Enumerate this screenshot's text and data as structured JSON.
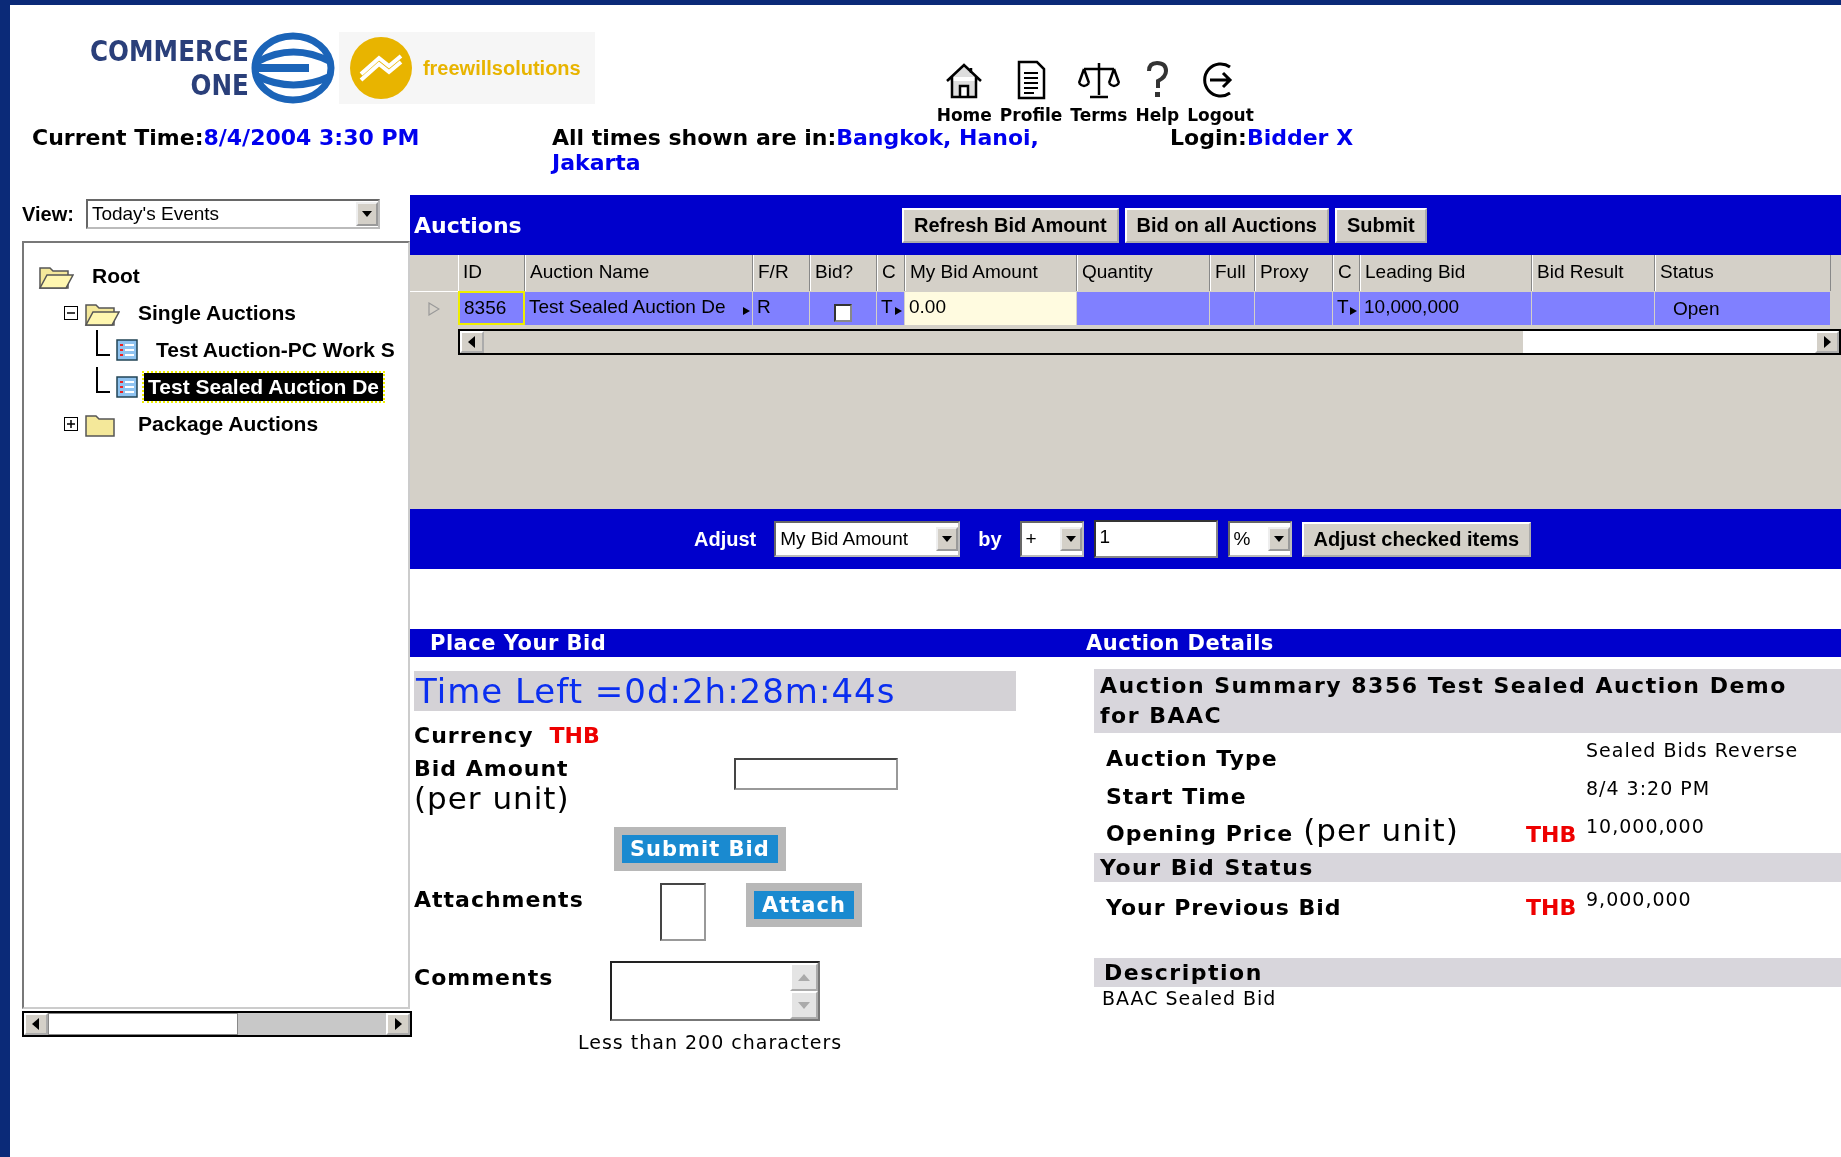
{
  "header": {
    "logo_commerce": [
      "COMMERCE",
      "ONE"
    ],
    "logo_freewill": "freewillsolutions",
    "nav": [
      {
        "label": "Home",
        "kind": "home"
      },
      {
        "label": "Profile",
        "kind": "profile"
      },
      {
        "label": "Terms",
        "kind": "terms"
      },
      {
        "label": "Help",
        "kind": "help"
      },
      {
        "label": "Logout",
        "kind": "logout"
      }
    ],
    "current_time": {
      "label": "Current Time:",
      "value": "8/4/2004 3:30 PM"
    },
    "timezone": {
      "label": "All times shown are in:",
      "value": "Bangkok, Hanoi, Jakarta"
    },
    "login": {
      "label": "Login:",
      "value": "Bidder X"
    }
  },
  "sidebar": {
    "view_label": "View:",
    "view_value": "Today's Events",
    "tree": [
      {
        "label": "Root",
        "kind": "root",
        "selected": false,
        "children": [
          {
            "label": "Single Auctions",
            "kind": "folder",
            "expanded": true,
            "selected": false,
            "children": [
              {
                "label": "Test Auction-PC Work S",
                "kind": "auction",
                "selected": false
              },
              {
                "label": "Test Sealed Auction De",
                "kind": "auction",
                "selected": true
              }
            ]
          },
          {
            "label": "Package Auctions",
            "kind": "folder",
            "expanded": false,
            "selected": false
          }
        ]
      }
    ]
  },
  "auctions": {
    "title": "Auctions",
    "buttons": [
      "Refresh Bid Amount",
      "Bid on all Auctions",
      "Submit"
    ],
    "columns": [
      "ID",
      "Auction Name",
      "F/R",
      "Bid?",
      "C",
      "My Bid Amount",
      "Quantity",
      "Full",
      "Proxy",
      "C",
      "Leading Bid",
      "Bid Result",
      "Status"
    ],
    "rows": [
      {
        "cells": [
          {
            "kind": "text",
            "text": "8356",
            "focused": true
          },
          {
            "kind": "menu",
            "text": "Test Sealed Auction De"
          },
          {
            "kind": "text",
            "text": "R"
          },
          {
            "kind": "checkbox",
            "checked": false
          },
          {
            "kind": "menu",
            "text": "T"
          },
          {
            "kind": "input",
            "text": "0.00"
          },
          {
            "kind": "blank"
          },
          {
            "kind": "blank"
          },
          {
            "kind": "blank"
          },
          {
            "kind": "menu",
            "text": "T"
          },
          {
            "kind": "text",
            "text": "10,000,000"
          },
          {
            "kind": "blank"
          },
          {
            "kind": "text",
            "text": "Open"
          }
        ]
      }
    ],
    "adjust": {
      "label": "Adjust",
      "field": "My Bid Amount",
      "by_label": "by",
      "operator": "+",
      "amount": "1",
      "unit": "%",
      "button": "Adjust checked items"
    }
  },
  "place_bid": {
    "title": "Place Your Bid",
    "time_left": "Time Left =0d:2h:28m:44s",
    "currency_label": "Currency",
    "currency": "THB",
    "bid_label": "Bid Amount",
    "bid_label_suffix": "(per unit)",
    "submit": "Submit Bid",
    "attachments_label": "Attachments",
    "attach": "Attach",
    "comments_label": "Comments",
    "comments_hint": "Less than 200 characters"
  },
  "auction_details": {
    "title": "Auction Details",
    "summary": "Auction Summary 8356 Test Sealed Auction Demo for BAAC",
    "rows": [
      {
        "label": "Auction Type",
        "value": "Sealed Bids Reverse"
      },
      {
        "label": "Start Time",
        "value": "8/4 3:20 PM"
      },
      {
        "label": "Opening Price",
        "label_suffix": "(per unit)",
        "currency": "THB",
        "value": "10,000,000"
      }
    ],
    "status_title": "Your Bid Status",
    "status_rows": [
      {
        "label": "Your Previous Bid",
        "currency": "THB",
        "value": "9,000,000"
      }
    ],
    "description_title": "Description",
    "description": "BAAC Sealed Bid"
  }
}
